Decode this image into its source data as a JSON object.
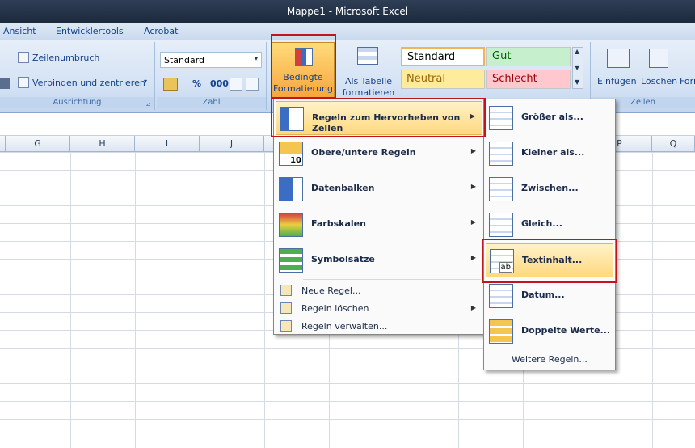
{
  "window": {
    "title": "Mappe1 - Microsoft Excel"
  },
  "tabs": [
    "Ansicht",
    "Entwicklertools",
    "Acrobat"
  ],
  "ribbon": {
    "ausrichtung": {
      "wrap": "Zeilenumbruch",
      "merge": "Verbinden und zentrieren",
      "label": "Ausrichtung"
    },
    "zahl": {
      "format": "Standard",
      "percent": "%",
      "thousands": "000",
      "label": "Zahl"
    },
    "cond_format": {
      "line1": "Bedingte",
      "line2": "Formatierung"
    },
    "as_table": {
      "line1": "Als Tabelle",
      "line2": "formatieren"
    },
    "styles": [
      {
        "name": "Standard",
        "bg": "#ffffff",
        "color": "#000000"
      },
      {
        "name": "Gut",
        "bg": "#c6efce",
        "color": "#006100"
      },
      {
        "name": "Neutral",
        "bg": "#ffeb9c",
        "color": "#9c6500"
      },
      {
        "name": "Schlecht",
        "bg": "#ffc7ce",
        "color": "#9c0006"
      }
    ],
    "cells": {
      "insert": "Einfügen",
      "delete": "Löschen",
      "format": "Form",
      "label": "Zellen"
    }
  },
  "columns": [
    "G",
    "H",
    "I",
    "J",
    "P",
    "Q"
  ],
  "menu_main": [
    {
      "label": "Regeln zum Hervorheben von Zellen",
      "arrow": "▶"
    },
    {
      "label": "Obere/untere Regeln",
      "arrow": "▶"
    },
    {
      "label": "Datenbalken",
      "arrow": "▶"
    },
    {
      "label": "Farbskalen",
      "arrow": "▶"
    },
    {
      "label": "Symbolsätze",
      "arrow": "▶"
    }
  ],
  "menu_main_small": [
    {
      "label": "Neue Regel..."
    },
    {
      "label": "Regeln löschen",
      "arrow": "▶"
    },
    {
      "label": "Regeln verwalten..."
    }
  ],
  "menu_sub": [
    {
      "label": "Größer als..."
    },
    {
      "label": "Kleiner als..."
    },
    {
      "label": "Zwischen..."
    },
    {
      "label": "Gleich..."
    },
    {
      "label": "Textinhalt..."
    },
    {
      "label": "Datum..."
    },
    {
      "label": "Doppelte Werte..."
    }
  ],
  "menu_sub_more": "Weitere Regeln...",
  "icons": {
    "ab": "ab",
    "ten": "10"
  }
}
